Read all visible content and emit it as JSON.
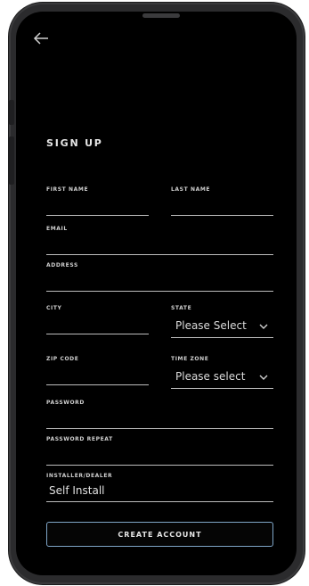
{
  "header": {
    "back_icon": "arrow-left-icon"
  },
  "form": {
    "title": "SIGN UP",
    "first_name_label": "FIRST NAME",
    "last_name_label": "LAST NAME",
    "email_label": "EMAIL",
    "address_label": "ADDRESS",
    "city_label": "CITY",
    "state_label": "STATE",
    "state_value": "Please Select",
    "zip_label": "ZIP CODE",
    "timezone_label": "TIME ZONE",
    "timezone_value": "Please select",
    "password_label": "PASSWORD",
    "password_repeat_label": "PASSWORD REPEAT",
    "installer_label": "INSTALLER/DEALER",
    "installer_value": "Self Install",
    "submit_label": "CREATE ACCOUNT"
  },
  "colors": {
    "background": "#000000",
    "button_border": "#7fa6c8"
  }
}
